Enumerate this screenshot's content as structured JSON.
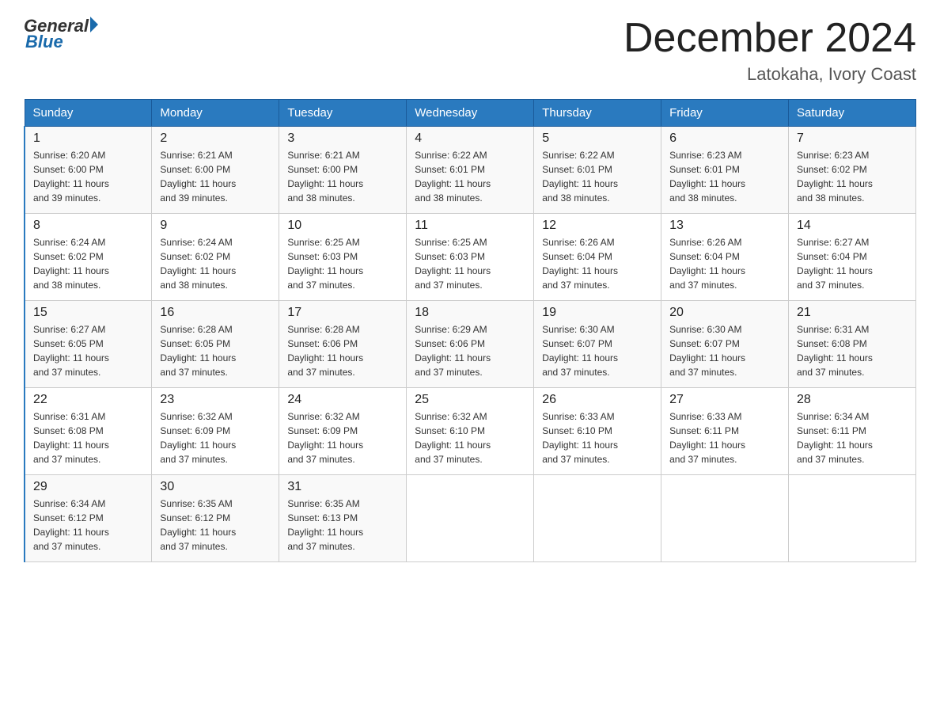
{
  "header": {
    "logo_general": "General",
    "logo_blue": "Blue",
    "title": "December 2024",
    "subtitle": "Latokaha, Ivory Coast"
  },
  "days_of_week": [
    "Sunday",
    "Monday",
    "Tuesday",
    "Wednesday",
    "Thursday",
    "Friday",
    "Saturday"
  ],
  "weeks": [
    [
      {
        "day": "1",
        "sunrise": "6:20 AM",
        "sunset": "6:00 PM",
        "daylight": "11 hours and 39 minutes."
      },
      {
        "day": "2",
        "sunrise": "6:21 AM",
        "sunset": "6:00 PM",
        "daylight": "11 hours and 39 minutes."
      },
      {
        "day": "3",
        "sunrise": "6:21 AM",
        "sunset": "6:00 PM",
        "daylight": "11 hours and 38 minutes."
      },
      {
        "day": "4",
        "sunrise": "6:22 AM",
        "sunset": "6:01 PM",
        "daylight": "11 hours and 38 minutes."
      },
      {
        "day": "5",
        "sunrise": "6:22 AM",
        "sunset": "6:01 PM",
        "daylight": "11 hours and 38 minutes."
      },
      {
        "day": "6",
        "sunrise": "6:23 AM",
        "sunset": "6:01 PM",
        "daylight": "11 hours and 38 minutes."
      },
      {
        "day": "7",
        "sunrise": "6:23 AM",
        "sunset": "6:02 PM",
        "daylight": "11 hours and 38 minutes."
      }
    ],
    [
      {
        "day": "8",
        "sunrise": "6:24 AM",
        "sunset": "6:02 PM",
        "daylight": "11 hours and 38 minutes."
      },
      {
        "day": "9",
        "sunrise": "6:24 AM",
        "sunset": "6:02 PM",
        "daylight": "11 hours and 38 minutes."
      },
      {
        "day": "10",
        "sunrise": "6:25 AM",
        "sunset": "6:03 PM",
        "daylight": "11 hours and 37 minutes."
      },
      {
        "day": "11",
        "sunrise": "6:25 AM",
        "sunset": "6:03 PM",
        "daylight": "11 hours and 37 minutes."
      },
      {
        "day": "12",
        "sunrise": "6:26 AM",
        "sunset": "6:04 PM",
        "daylight": "11 hours and 37 minutes."
      },
      {
        "day": "13",
        "sunrise": "6:26 AM",
        "sunset": "6:04 PM",
        "daylight": "11 hours and 37 minutes."
      },
      {
        "day": "14",
        "sunrise": "6:27 AM",
        "sunset": "6:04 PM",
        "daylight": "11 hours and 37 minutes."
      }
    ],
    [
      {
        "day": "15",
        "sunrise": "6:27 AM",
        "sunset": "6:05 PM",
        "daylight": "11 hours and 37 minutes."
      },
      {
        "day": "16",
        "sunrise": "6:28 AM",
        "sunset": "6:05 PM",
        "daylight": "11 hours and 37 minutes."
      },
      {
        "day": "17",
        "sunrise": "6:28 AM",
        "sunset": "6:06 PM",
        "daylight": "11 hours and 37 minutes."
      },
      {
        "day": "18",
        "sunrise": "6:29 AM",
        "sunset": "6:06 PM",
        "daylight": "11 hours and 37 minutes."
      },
      {
        "day": "19",
        "sunrise": "6:30 AM",
        "sunset": "6:07 PM",
        "daylight": "11 hours and 37 minutes."
      },
      {
        "day": "20",
        "sunrise": "6:30 AM",
        "sunset": "6:07 PM",
        "daylight": "11 hours and 37 minutes."
      },
      {
        "day": "21",
        "sunrise": "6:31 AM",
        "sunset": "6:08 PM",
        "daylight": "11 hours and 37 minutes."
      }
    ],
    [
      {
        "day": "22",
        "sunrise": "6:31 AM",
        "sunset": "6:08 PM",
        "daylight": "11 hours and 37 minutes."
      },
      {
        "day": "23",
        "sunrise": "6:32 AM",
        "sunset": "6:09 PM",
        "daylight": "11 hours and 37 minutes."
      },
      {
        "day": "24",
        "sunrise": "6:32 AM",
        "sunset": "6:09 PM",
        "daylight": "11 hours and 37 minutes."
      },
      {
        "day": "25",
        "sunrise": "6:32 AM",
        "sunset": "6:10 PM",
        "daylight": "11 hours and 37 minutes."
      },
      {
        "day": "26",
        "sunrise": "6:33 AM",
        "sunset": "6:10 PM",
        "daylight": "11 hours and 37 minutes."
      },
      {
        "day": "27",
        "sunrise": "6:33 AM",
        "sunset": "6:11 PM",
        "daylight": "11 hours and 37 minutes."
      },
      {
        "day": "28",
        "sunrise": "6:34 AM",
        "sunset": "6:11 PM",
        "daylight": "11 hours and 37 minutes."
      }
    ],
    [
      {
        "day": "29",
        "sunrise": "6:34 AM",
        "sunset": "6:12 PM",
        "daylight": "11 hours and 37 minutes."
      },
      {
        "day": "30",
        "sunrise": "6:35 AM",
        "sunset": "6:12 PM",
        "daylight": "11 hours and 37 minutes."
      },
      {
        "day": "31",
        "sunrise": "6:35 AM",
        "sunset": "6:13 PM",
        "daylight": "11 hours and 37 minutes."
      },
      null,
      null,
      null,
      null
    ]
  ],
  "labels": {
    "sunrise": "Sunrise:",
    "sunset": "Sunset:",
    "daylight": "Daylight:"
  }
}
